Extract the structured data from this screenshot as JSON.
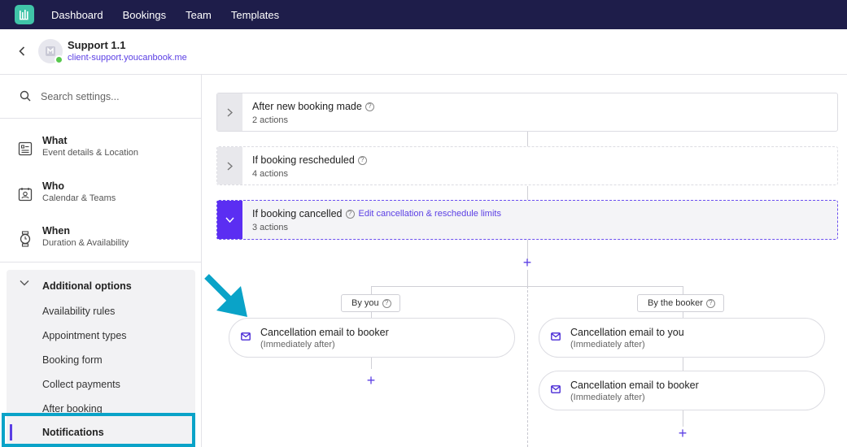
{
  "nav": {
    "items": [
      "Dashboard",
      "Bookings",
      "Team",
      "Templates"
    ]
  },
  "header": {
    "title": "Support 1.1",
    "link": "client-support.youcanbook.me"
  },
  "sidebar": {
    "search_placeholder": "Search settings...",
    "sections": [
      {
        "title": "What",
        "subtitle": "Event details & Location",
        "icon": "form-icon"
      },
      {
        "title": "Who",
        "subtitle": "Calendar & Teams",
        "icon": "person-icon"
      },
      {
        "title": "When",
        "subtitle": "Duration & Availability",
        "icon": "watch-icon"
      }
    ],
    "additional": {
      "label": "Additional options",
      "items": [
        "Availability rules",
        "Appointment types",
        "Booking form",
        "Collect payments",
        "After booking",
        "Notifications"
      ]
    }
  },
  "triggers": [
    {
      "title": "After new booking made",
      "subtitle": "2 actions"
    },
    {
      "title": "If booking rescheduled",
      "subtitle": "4 actions"
    },
    {
      "title": "If booking cancelled",
      "subtitle": "3 actions",
      "link": "Edit cancellation & reschedule limits"
    }
  ],
  "branches": {
    "left_label": "By you",
    "right_label": "By the booker"
  },
  "actions": {
    "left": [
      {
        "title": "Cancellation email to booker",
        "subtitle": "(Immediately after)"
      }
    ],
    "right": [
      {
        "title": "Cancellation email to you",
        "subtitle": "(Immediately after)"
      },
      {
        "title": "Cancellation email to booker",
        "subtitle": "(Immediately after)"
      }
    ]
  },
  "colors": {
    "nav_bg": "#1e1d4a",
    "accent": "#5b3fe4",
    "highlight": "#0aa3c8",
    "logo": "#40c4a8"
  }
}
